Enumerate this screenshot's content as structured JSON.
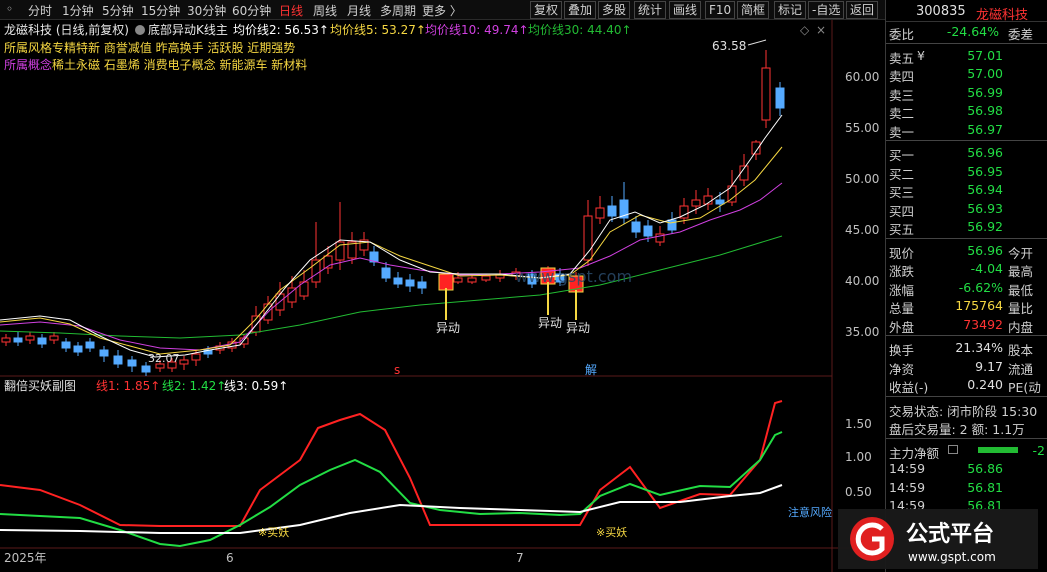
{
  "toolbar": {
    "items": [
      "分时",
      "1分钟",
      "5分钟",
      "15分钟",
      "30分钟",
      "60分钟",
      "日线",
      "周线",
      "月线",
      "多周期",
      "更多 〉"
    ],
    "right_items": [
      "复权",
      "叠加",
      "多股",
      "统计",
      "画线",
      "F10",
      "简框",
      "标记",
      "-自选",
      "返回"
    ]
  },
  "chart": {
    "header": {
      "stock": "龙磁科技 (日线,前复权)",
      "indicator": "底部异动K线主",
      "ma2": "均价线2: 56.53↑",
      "ma5": "均价线5: 53.27↑",
      "ma10": "均价线10: 49.74↑",
      "ma30": "均价线30: 44.40↑"
    },
    "tags_line1": "所属风格专精特新 商誉减值 昨高换手 活跃股 近期强势",
    "tags_line2_prefix": "所属概念",
    "tags_line2": "稀土永磁 石墨烯 消费电子概念 新能源车 新材料",
    "high_label": "63.58",
    "low_label": "32.07",
    "price_axis": [
      "60.00",
      "55.00",
      "50.00",
      "45.00",
      "40.00",
      "35.00"
    ],
    "signal_label": "异动",
    "marker_s": "s",
    "marker_jie": "解",
    "watermark": "www.gspt.com"
  },
  "sub": {
    "title": "翻倍买妖副图",
    "line1": "线1: 1.85↑",
    "line2": "线2: 1.42↑",
    "line3": "线3: 0.59↑",
    "axis": [
      "1.50",
      "1.00",
      "0.50"
    ],
    "buy_label": "※买妖",
    "warn_label": "注意风险"
  },
  "date_axis": [
    "2025年",
    "6",
    "7"
  ],
  "quote": {
    "code": "300835",
    "name": "龙磁科技",
    "ratio_label": "委比",
    "ratio_value": "-24.64%",
    "ratio_tail": "委差",
    "asks": [
      {
        "label": "卖五",
        "price": "57.01"
      },
      {
        "label": "卖四",
        "price": "57.00"
      },
      {
        "label": "卖三",
        "price": "56.99"
      },
      {
        "label": "卖二",
        "price": "56.98"
      },
      {
        "label": "卖一",
        "price": "56.97"
      }
    ],
    "bids": [
      {
        "label": "买一",
        "price": "56.96"
      },
      {
        "label": "买二",
        "price": "56.95"
      },
      {
        "label": "买三",
        "price": "56.94"
      },
      {
        "label": "买四",
        "price": "56.93"
      },
      {
        "label": "买五",
        "price": "56.92"
      }
    ],
    "ask_mark": "¥",
    "stats": [
      {
        "label": "现价",
        "value": "56.96",
        "tail": "今开",
        "color": "g"
      },
      {
        "label": "涨跌",
        "value": "-4.04",
        "tail": "最高",
        "color": "g"
      },
      {
        "label": "涨幅",
        "value": "-6.62%",
        "tail": "最低",
        "color": "g"
      },
      {
        "label": "总量",
        "value": "175764",
        "tail": "量比",
        "color": "y"
      },
      {
        "label": "外盘",
        "value": "73492",
        "tail": "内盘",
        "color": "r"
      }
    ],
    "stats2": [
      {
        "label": "换手",
        "value": "21.34%",
        "tail": "股本",
        "color": "w"
      },
      {
        "label": "净资",
        "value": "9.17",
        "tail": "流通",
        "color": "w"
      },
      {
        "label": "收益(-)",
        "value": "0.240",
        "tail": "PE(动",
        "color": "w"
      }
    ],
    "trade_status": "交易状态: 闭市阶段 15:30",
    "after_hours": "盘后交易量: 2 额: 1.1万",
    "main_flow_label": "主力净额",
    "main_flow_value": "-2",
    "ticks": [
      {
        "time": "14:59",
        "price": "56.86"
      },
      {
        "time": "14:59",
        "price": "56.81"
      },
      {
        "time": "14:59",
        "price": "56.81"
      }
    ]
  },
  "logo": {
    "title": "公式平台",
    "url": "www.gspt.com"
  },
  "colors": {
    "up": "#ff3333",
    "down": "#22dd44",
    "ma_white": "#ffffff",
    "ma_yellow": "#f5d742",
    "ma_magenta": "#d040e0",
    "ma_green": "#22bb33",
    "candle_fill_down": "#55aaff"
  }
}
